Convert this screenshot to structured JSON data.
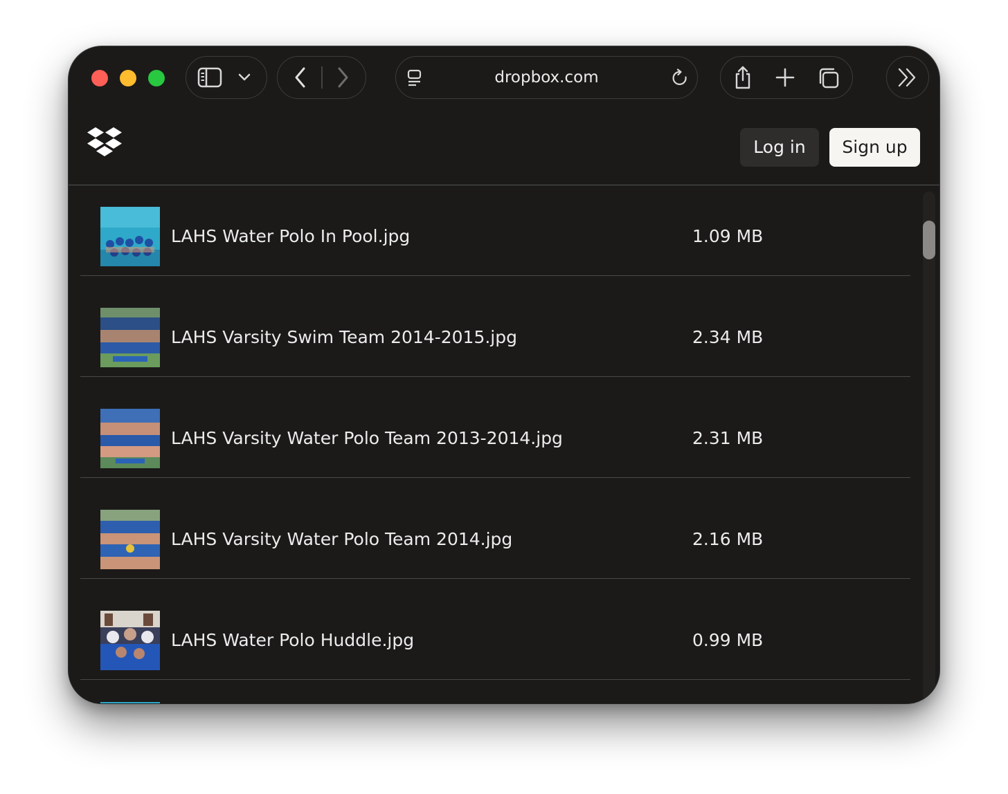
{
  "browser": {
    "url": "dropbox.com",
    "icons": [
      "sidebar-icon",
      "chevron-down-icon",
      "back-icon",
      "forward-icon",
      "page-menu-icon",
      "reload-icon",
      "share-icon",
      "plus-icon",
      "tabs-icon",
      "double-chevron-right-icon"
    ]
  },
  "header": {
    "logo": "dropbox-logo",
    "login_label": "Log in",
    "signup_label": "Sign up"
  },
  "files": [
    {
      "name": "LAHS Water Polo In Pool.jpg",
      "size": "1.09 MB"
    },
    {
      "name": "LAHS Varsity Swim Team 2014-2015.jpg",
      "size": "2.34 MB"
    },
    {
      "name": "LAHS Varsity Water Polo Team 2013-2014.jpg",
      "size": "2.31 MB"
    },
    {
      "name": "LAHS Varsity Water Polo Team 2014.jpg",
      "size": "2.16 MB"
    },
    {
      "name": "LAHS Water Polo Huddle.jpg",
      "size": "0.99 MB"
    }
  ],
  "colors": {
    "window_bg": "#1b1a19",
    "close": "#fe5f57",
    "minimize": "#febc2e",
    "zoom": "#28c840"
  }
}
